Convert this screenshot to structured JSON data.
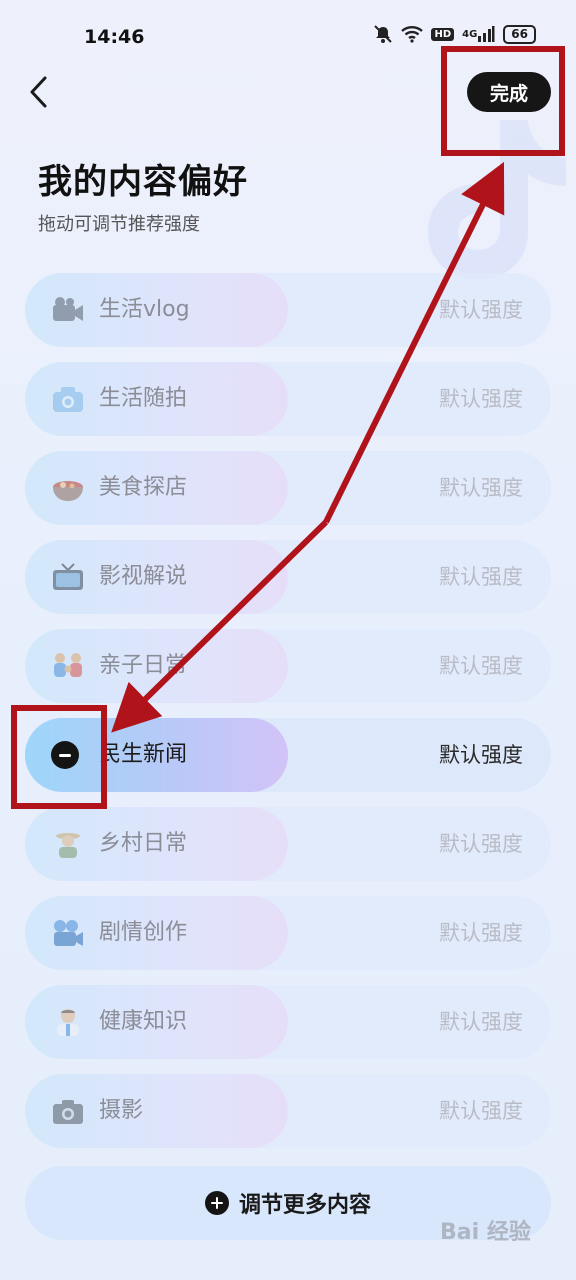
{
  "status_bar": {
    "time": "14:46",
    "battery": "66",
    "hd": "HD",
    "network": "4G"
  },
  "header": {
    "done_label": "完成"
  },
  "page": {
    "title": "我的内容偏好",
    "subtitle": "拖动可调节推荐强度"
  },
  "categories": [
    {
      "label": "生活vlog",
      "strength": "默认强度",
      "icon": "video-camera-icon"
    },
    {
      "label": "生活随拍",
      "strength": "默认强度",
      "icon": "camera-icon"
    },
    {
      "label": "美食探店",
      "strength": "默认强度",
      "icon": "food-bowl-icon"
    },
    {
      "label": "影视解说",
      "strength": "默认强度",
      "icon": "tv-icon"
    },
    {
      "label": "亲子日常",
      "strength": "默认强度",
      "icon": "family-icon"
    },
    {
      "label": "民生新闻",
      "strength": "默认强度",
      "icon": "minus-icon",
      "active": true
    },
    {
      "label": "乡村日常",
      "strength": "默认强度",
      "icon": "farmer-icon"
    },
    {
      "label": "剧情创作",
      "strength": "默认强度",
      "icon": "film-camera-icon"
    },
    {
      "label": "健康知识",
      "strength": "默认强度",
      "icon": "doctor-icon"
    },
    {
      "label": "摄影",
      "strength": "默认强度",
      "icon": "photo-camera-icon"
    }
  ],
  "more": {
    "label": "调节更多内容"
  },
  "watermark": "Bai 经验",
  "annotation_color": "#b0141a"
}
